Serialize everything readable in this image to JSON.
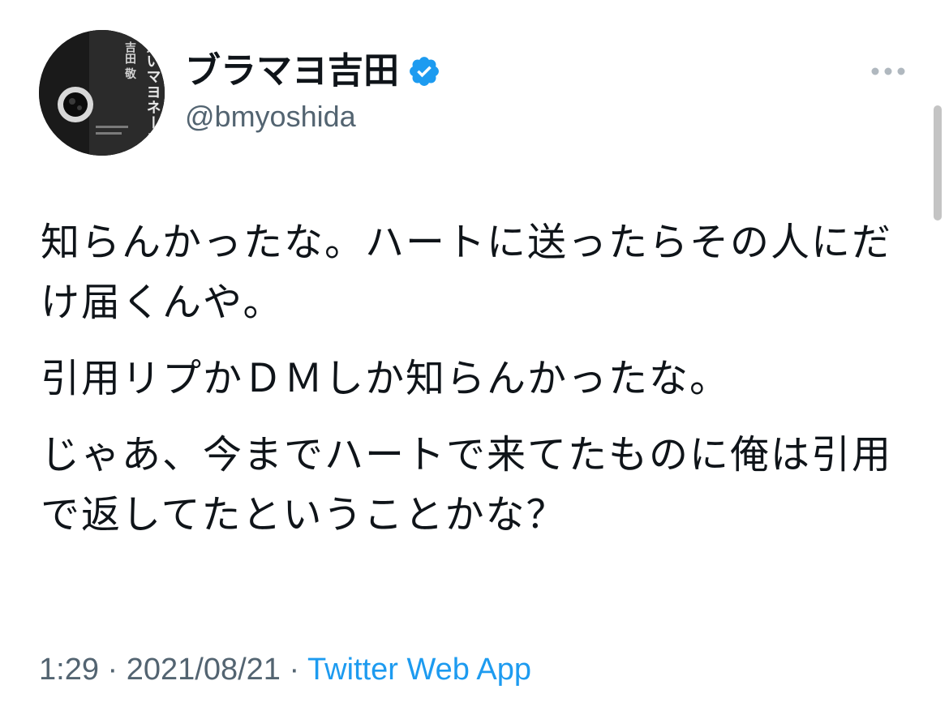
{
  "tweet": {
    "author": {
      "display_name": "ブラマヨ吉田",
      "handle": "@bmyoshida",
      "verified": true,
      "avatar_text": {
        "title": "黒いマヨネーズ",
        "name": "吉田 敬"
      }
    },
    "paragraphs": [
      "知らんかったな。ハートに送ったらその人にだけ届くんや。",
      "引用リプかＤＭしか知らんかったな。",
      "じゃあ、今までハートで来てたものに俺は引用で返してたということかな？"
    ],
    "time": "1:29",
    "date": "2021/08/21",
    "separator": "·",
    "source": "Twitter Web App"
  },
  "colors": {
    "text": "#0f1419",
    "secondary": "#536471",
    "accent": "#1d9bf0",
    "verified": "#1d9bf0"
  },
  "icons": {
    "verified": "verified-badge-icon",
    "more": "more-horizontal-icon"
  }
}
